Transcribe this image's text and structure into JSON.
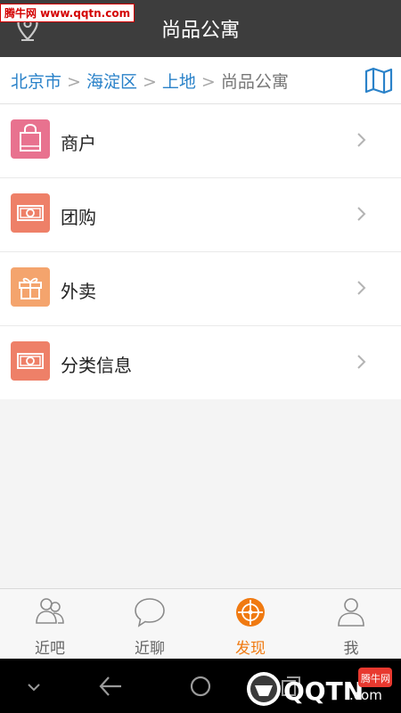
{
  "header": {
    "title": "尚品公寓",
    "watermark": "腾牛网 www.qqtn.com"
  },
  "breadcrumb": {
    "items": [
      "北京市",
      "海淀区",
      "上地"
    ],
    "current": "尚品公寓",
    "separator": ">"
  },
  "list": {
    "items": [
      {
        "label": "商户",
        "icon": "shopping-bag-icon",
        "color": "#e8728f"
      },
      {
        "label": "团购",
        "icon": "banknote-icon",
        "color": "#ee8068"
      },
      {
        "label": "外卖",
        "icon": "gift-icon",
        "color": "#f4a46d"
      },
      {
        "label": "分类信息",
        "icon": "banknote-icon",
        "color": "#ee8068"
      }
    ]
  },
  "bottom_nav": {
    "tabs": [
      {
        "label": "近吧",
        "icon": "people-icon",
        "active": false
      },
      {
        "label": "近聊",
        "icon": "chat-bubble-icon",
        "active": false
      },
      {
        "label": "发现",
        "icon": "compass-target-icon",
        "active": true
      },
      {
        "label": "我",
        "icon": "person-icon",
        "active": false
      }
    ]
  },
  "watermark_bottom": {
    "brand": "QQTN",
    "suffix": ".com",
    "site": "腾牛网"
  },
  "colors": {
    "accent": "#f07a11",
    "link": "#2a82c9",
    "header_bg": "#3d3d3d"
  }
}
